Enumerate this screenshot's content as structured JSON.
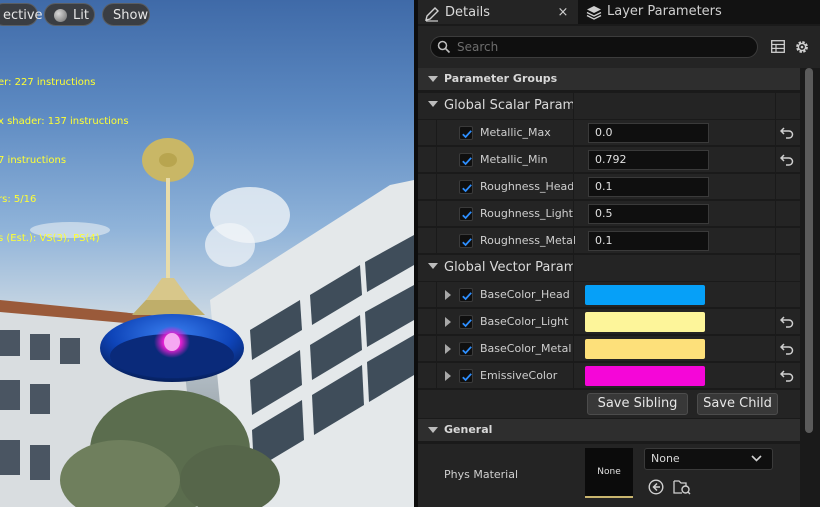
{
  "viewport": {
    "perspective_label": "ective",
    "lit_label": "Lit",
    "show_label": "Show",
    "stats": [
      "er: 227 instructions",
      "x shader: 137 instructions",
      "7 instructions",
      "rs: 5/16",
      "s (Est.): VS(3), PS(4)"
    ]
  },
  "tabs": {
    "details": "Details",
    "close": "×",
    "layer_parameters": "Layer Parameters"
  },
  "search": {
    "placeholder": "Search"
  },
  "sections": {
    "parameter_groups": "Parameter Groups",
    "general": "General"
  },
  "scalar_group": {
    "title": "Global Scalar Paramet",
    "params": [
      {
        "name": "Metallic_Max",
        "value": "0.0",
        "resettable": true
      },
      {
        "name": "Metallic_Min",
        "value": "0.792",
        "resettable": true
      },
      {
        "name": "Roughness_Head",
        "value": "0.1",
        "resettable": false
      },
      {
        "name": "Roughness_Light",
        "value": "0.5",
        "resettable": false
      },
      {
        "name": "Roughness_Metal",
        "value": "0.1",
        "resettable": false
      }
    ]
  },
  "vector_group": {
    "title": "Global Vector Paramet",
    "params": [
      {
        "name": "BaseColor_Head",
        "color": "#06a0f8",
        "resettable": false
      },
      {
        "name": "BaseColor_Light",
        "color": "#fdf59a",
        "resettable": true
      },
      {
        "name": "BaseColor_Metal",
        "color": "#fde07a",
        "resettable": true
      },
      {
        "name": "EmissiveColor",
        "color": "#f506d8",
        "resettable": true
      }
    ]
  },
  "buttons": {
    "save_sibling": "Save Sibling",
    "save_child": "Save Child"
  },
  "general": {
    "phys_material_label": "Phys Material",
    "thumbnail_text": "None",
    "combo_value": "None"
  }
}
